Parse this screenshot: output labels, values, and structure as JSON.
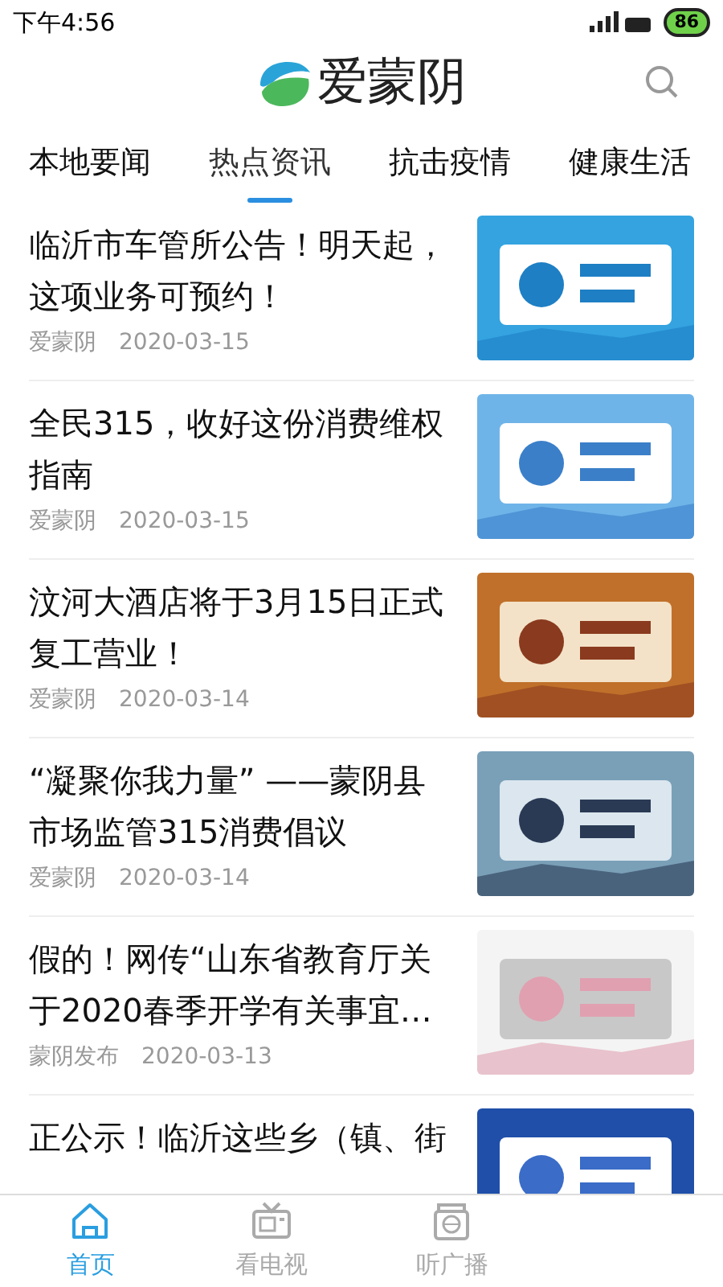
{
  "status_bar": {
    "time": "下午4:56",
    "battery": "86"
  },
  "header": {
    "title": "爱蒙阴"
  },
  "tabs": [
    {
      "label": "本地要闻",
      "selected": false
    },
    {
      "label": "热点资讯",
      "selected": true
    },
    {
      "label": "抗击疫情",
      "selected": false
    },
    {
      "label": "健康生活",
      "selected": false
    }
  ],
  "articles": [
    {
      "title": "临沂市车管所公告！明天起，这项业务可预约！",
      "source": "爱蒙阴",
      "date": "2020-03-15"
    },
    {
      "title": "全民315，收好这份消费维权指南",
      "source": "爱蒙阴",
      "date": "2020-03-15"
    },
    {
      "title": "汶河大酒店将于3月15日正式复工营业！",
      "source": "爱蒙阴",
      "date": "2020-03-14"
    },
    {
      "title": "“凝聚你我力量” ——蒙阴县市场监管315消费倡议",
      "source": "爱蒙阴",
      "date": "2020-03-14"
    },
    {
      "title": "假的！网传“山东省教育厅关于2020春季开学有关事宜…",
      "source": "蒙阴发布",
      "date": "2020-03-13"
    },
    {
      "title": "正公示！临沂这些乡（镇、街"
    }
  ],
  "bottom_nav": [
    {
      "label": "首页",
      "selected": true,
      "kind": "home"
    },
    {
      "label": "看电视",
      "selected": false,
      "kind": "tv"
    },
    {
      "label": "听广播",
      "selected": false,
      "kind": "radio"
    }
  ]
}
